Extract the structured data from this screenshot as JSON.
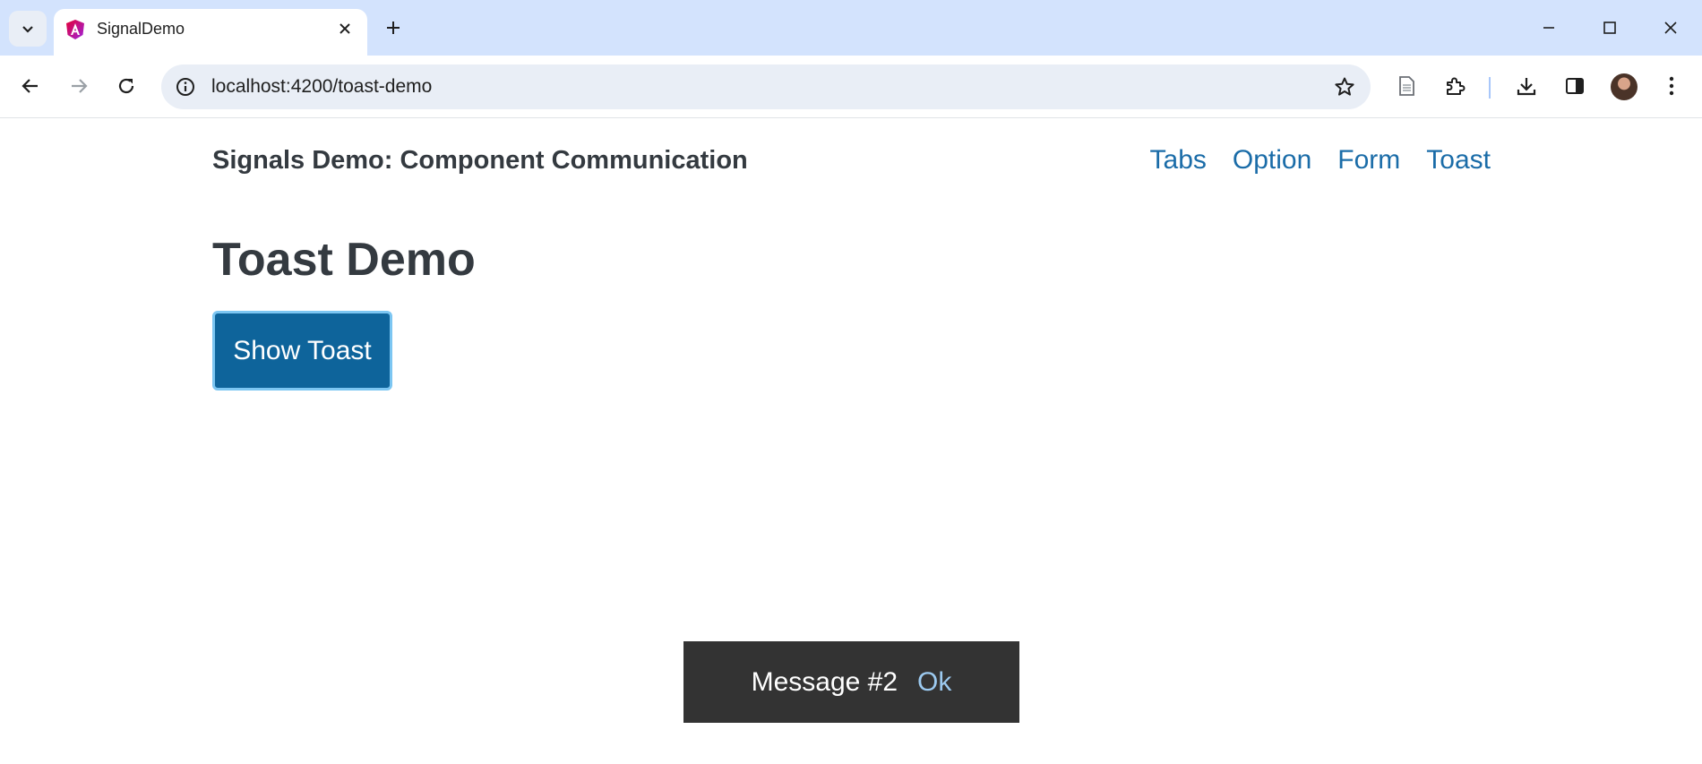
{
  "browser": {
    "tab": {
      "title": "SignalDemo",
      "favicon": "angular-logo-icon"
    },
    "address_bar": {
      "url": "localhost:4200/toast-demo"
    },
    "icons": {
      "tab_search": "chevron-down-icon",
      "new_tab": "plus-icon",
      "back": "arrow-left-icon",
      "forward": "arrow-right-icon",
      "reload": "reload-icon",
      "site_info": "info-icon",
      "bookmark": "star-icon",
      "reading_list": "document-icon",
      "extensions": "puzzle-icon",
      "downloads": "download-icon",
      "side_panel": "side-panel-icon",
      "profile": "avatar",
      "menu": "kebab-menu-icon"
    }
  },
  "page": {
    "brand": "Signals Demo: Component Communication",
    "nav": [
      {
        "label": "Tabs"
      },
      {
        "label": "Option"
      },
      {
        "label": "Form"
      },
      {
        "label": "Toast"
      }
    ],
    "heading": "Toast Demo",
    "show_toast_button": "Show Toast",
    "toast": {
      "message": "Message #2",
      "action": "Ok"
    }
  },
  "colors": {
    "tabstrip": "#d3e3fd",
    "link": "#1a6ca8",
    "primary_button": "#0e649b",
    "toast_background": "#333333",
    "toast_action": "#9ccaf0"
  }
}
